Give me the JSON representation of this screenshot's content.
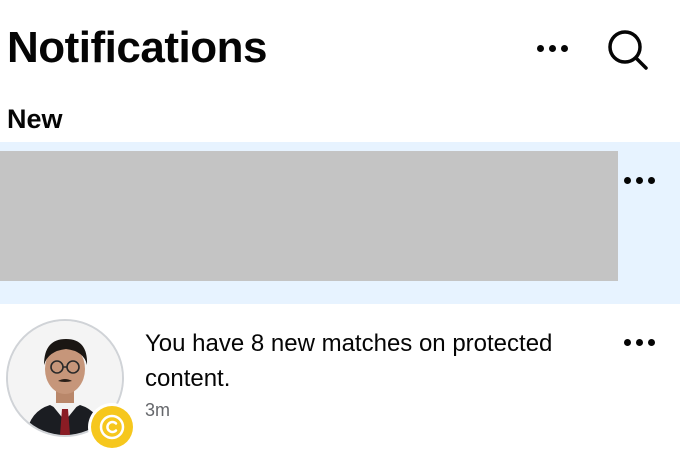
{
  "header": {
    "title": "Notifications",
    "more_icon": "more-horizontal-icon",
    "search_icon": "search-icon"
  },
  "sections": {
    "new_label": "New"
  },
  "notifications": [
    {
      "redacted": true,
      "more_icon": "more-horizontal-icon"
    },
    {
      "text": "You have 8 new matches on protected content.",
      "time": "3m",
      "avatar": "profile-photo",
      "badge_icon": "copyright-icon",
      "more_icon": "more-horizontal-icon"
    }
  ],
  "colors": {
    "unread_background": "#e7f3ff",
    "badge": "#f6c71d",
    "secondary_text": "#65676b",
    "redaction": "#c4c4c4"
  }
}
